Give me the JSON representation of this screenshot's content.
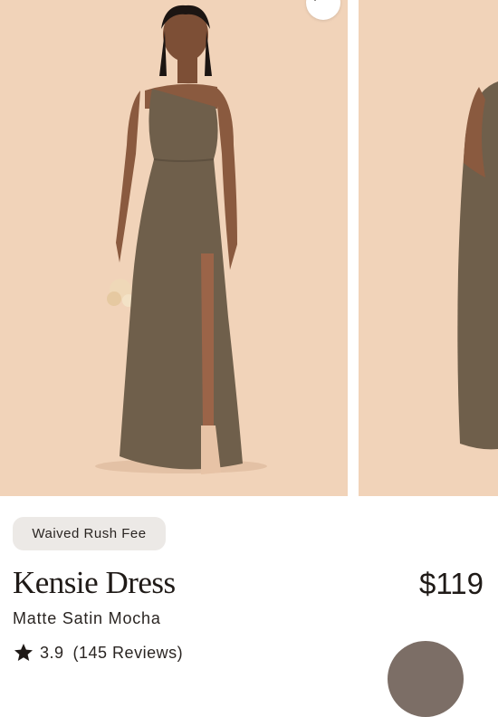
{
  "product": {
    "badge": "Waived Rush Fee",
    "name": "Kensie Dress",
    "price": "$119",
    "variant": "Matte Satin Mocha",
    "rating": {
      "score": "3.9",
      "reviews": "(145 Reviews)",
      "icon": "star-icon"
    }
  },
  "gallery": {
    "favorite_icon": "heart-icon",
    "images": [
      "model-photo-front",
      "model-photo-side"
    ]
  },
  "colors": {
    "background_photo": "#f1d3b9",
    "dress": "#6f5f4b",
    "swatch": "#7c6e66",
    "badge_bg": "#ece9e6"
  }
}
